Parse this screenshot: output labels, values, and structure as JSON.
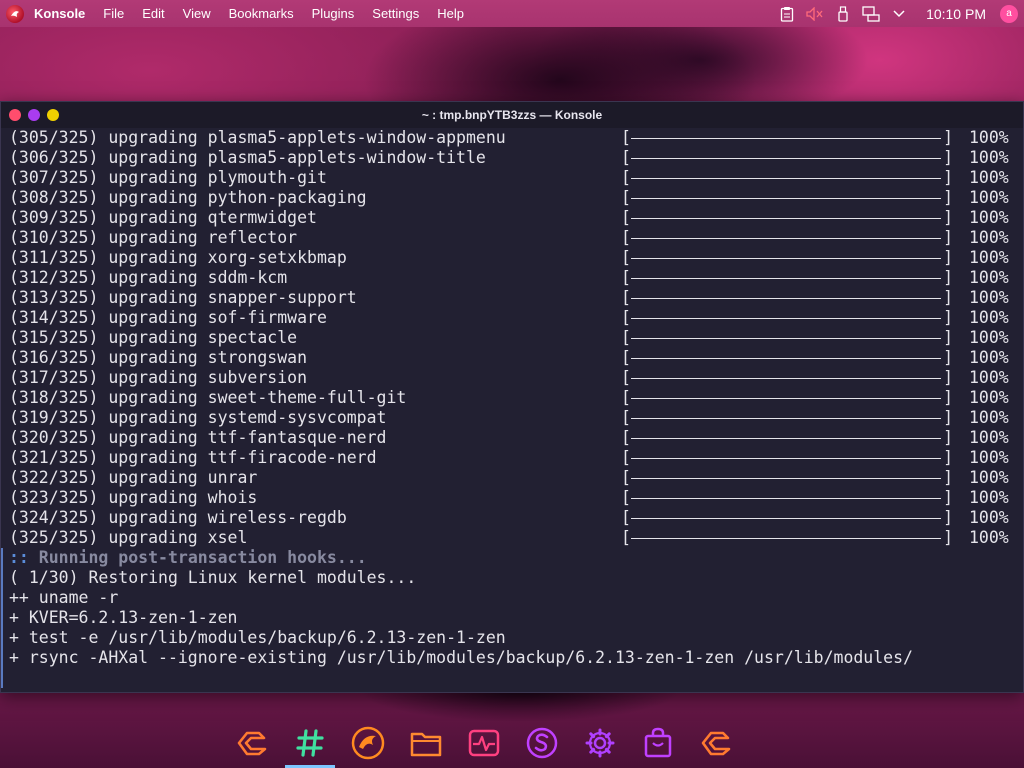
{
  "colors": {
    "panel": "#b23a76",
    "terminal_bg": "#222032",
    "close": "#ff4d6d",
    "minimize": "#a93cf0",
    "maximize": "#f0d000"
  },
  "top_panel": {
    "app_name": "Konsole",
    "menu": [
      "File",
      "Edit",
      "View",
      "Bookmarks",
      "Plugins",
      "Settings",
      "Help"
    ],
    "clock": "10:10 PM",
    "avatar_letter": "a"
  },
  "window": {
    "title": "~ : tmp.bnpYTB3zzs — Konsole"
  },
  "terminal": {
    "progress_lines": [
      {
        "counter": "(305/325)",
        "action": "upgrading",
        "package": "plasma5-applets-window-appmenu",
        "percent": "100%"
      },
      {
        "counter": "(306/325)",
        "action": "upgrading",
        "package": "plasma5-applets-window-title",
        "percent": "100%"
      },
      {
        "counter": "(307/325)",
        "action": "upgrading",
        "package": "plymouth-git",
        "percent": "100%"
      },
      {
        "counter": "(308/325)",
        "action": "upgrading",
        "package": "python-packaging",
        "percent": "100%"
      },
      {
        "counter": "(309/325)",
        "action": "upgrading",
        "package": "qtermwidget",
        "percent": "100%"
      },
      {
        "counter": "(310/325)",
        "action": "upgrading",
        "package": "reflector",
        "percent": "100%"
      },
      {
        "counter": "(311/325)",
        "action": "upgrading",
        "package": "xorg-setxkbmap",
        "percent": "100%"
      },
      {
        "counter": "(312/325)",
        "action": "upgrading",
        "package": "sddm-kcm",
        "percent": "100%"
      },
      {
        "counter": "(313/325)",
        "action": "upgrading",
        "package": "snapper-support",
        "percent": "100%"
      },
      {
        "counter": "(314/325)",
        "action": "upgrading",
        "package": "sof-firmware",
        "percent": "100%"
      },
      {
        "counter": "(315/325)",
        "action": "upgrading",
        "package": "spectacle",
        "percent": "100%"
      },
      {
        "counter": "(316/325)",
        "action": "upgrading",
        "package": "strongswan",
        "percent": "100%"
      },
      {
        "counter": "(317/325)",
        "action": "upgrading",
        "package": "subversion",
        "percent": "100%"
      },
      {
        "counter": "(318/325)",
        "action": "upgrading",
        "package": "sweet-theme-full-git",
        "percent": "100%"
      },
      {
        "counter": "(319/325)",
        "action": "upgrading",
        "package": "systemd-sysvcompat",
        "percent": "100%"
      },
      {
        "counter": "(320/325)",
        "action": "upgrading",
        "package": "ttf-fantasque-nerd",
        "percent": "100%"
      },
      {
        "counter": "(321/325)",
        "action": "upgrading",
        "package": "ttf-firacode-nerd",
        "percent": "100%"
      },
      {
        "counter": "(322/325)",
        "action": "upgrading",
        "package": "unrar",
        "percent": "100%"
      },
      {
        "counter": "(323/325)",
        "action": "upgrading",
        "package": "whois",
        "percent": "100%"
      },
      {
        "counter": "(324/325)",
        "action": "upgrading",
        "package": "wireless-regdb",
        "percent": "100%"
      },
      {
        "counter": "(325/325)",
        "action": "upgrading",
        "package": "xsel",
        "percent": "100%"
      }
    ],
    "hook_prefix": "::",
    "hook_text": "Running post-transaction hooks...",
    "output_lines": [
      "( 1/30) Restoring Linux kernel modules...",
      "++ uname -r",
      "+ KVER=6.2.13-zen-1-zen",
      "+ test -e /usr/lib/modules/backup/6.2.13-zen-1-zen",
      "+ rsync -AHXal --ignore-existing /usr/lib/modules/backup/6.2.13-zen-1-zen /usr/lib/modules/"
    ]
  },
  "dock": {
    "items": [
      {
        "icon": "garuda-icon",
        "color": "#ff7a30"
      },
      {
        "icon": "hashtag-icon",
        "color": "#40e0a0",
        "active": true
      },
      {
        "icon": "garuda-dragon-icon",
        "color": "#ff8a20"
      },
      {
        "icon": "folder-icon",
        "color": "#ff8a30"
      },
      {
        "icon": "activity-monitor-icon",
        "color": "#ff4080"
      },
      {
        "icon": "s-app-icon",
        "color": "#c040ff"
      },
      {
        "icon": "settings-gear-icon",
        "color": "#b040ff"
      },
      {
        "icon": "store-bag-icon",
        "color": "#c040ff"
      },
      {
        "icon": "garuda-settings-icon",
        "color": "#ff7a30"
      }
    ]
  }
}
